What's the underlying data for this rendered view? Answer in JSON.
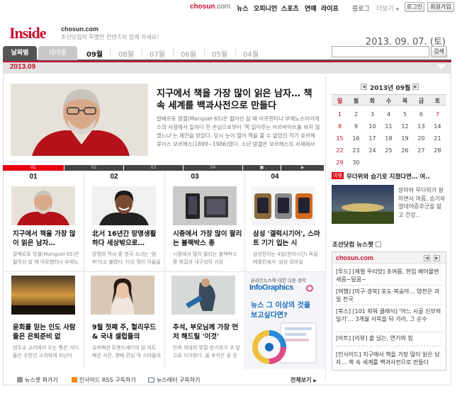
{
  "top_nav": {
    "logo": "chosun",
    "logo_suffix": ".com",
    "links": [
      "뉴스",
      "오피니언",
      "스포츠",
      "연예",
      "라이프"
    ],
    "blog": "블로그",
    "more": "더보기",
    "login": "로그인",
    "signup": "회원가입"
  },
  "brand": {
    "title": "Inside",
    "site": "chosun.com",
    "tagline": "조선닷컴의 특별한 컨텐츠와 함께 하세요!"
  },
  "date_display": "2013. 09. 07. (토)",
  "tabs": {
    "by_date": "날짜별",
    "by_theme": "테마별"
  },
  "months": [
    "09월",
    "08월",
    "07월",
    "06월",
    "05월",
    "04월"
  ],
  "search": {
    "button": "검색",
    "placeholder": ""
  },
  "current_month": "2013.09",
  "feature": {
    "title": "지구에서 책을 가장 많이 읽은 남자… 책 속 세계를 백과사전으로 만들다",
    "desc": "알베르토 망겔(Manguel·65)은 젊어선 살 때 아르헨티나 부에노스아이레스의 서점에서 일하다 한 손님으로부터 '책 읽어주는 아르바이트를 하지 않겠느냐'는 제안을 받았다. 당시 눈이 멀어 책을 볼 수 없었던 작가 호르헤 루이스 보르헤스(1899~1986)였다. 소년 망겔은 보르헤스의 서재에서"
  },
  "slider": {
    "segments": [
      "01",
      "02",
      "03",
      "04"
    ],
    "pause": "■",
    "next": "▶"
  },
  "grid": [
    {
      "num": "01",
      "title": "지구에서 책을 가장 많이 읽은 남자…",
      "desc": "알베르토 망겔(Manguel·65)은 젊어선 살 때 아르헨티나 부에노스"
    },
    {
      "num": "02",
      "title": "北서 16년간 망명생활하다 세상밖으로…",
      "desc": "망명의 역사 중 영국 소녀는 '캠퍼'라고 불렸다. 다섯 명이 아들을"
    },
    {
      "num": "03",
      "title": "시중에서 가장 많이 팔리는 블랙박스 총",
      "desc": "시중에서 많이 팔리는 블랙박스 중 화질과 내구성이 가장"
    },
    {
      "num": "04",
      "title": "삼성 '갤럭시기어', 스마트 기기 입는 시",
      "desc": "삼성전자는 4일(현지시간) 독일 베를린에서 '삼성 모바일"
    },
    {
      "num": "",
      "title": "윤회를 믿는 인도 사람들은 은퇴준비 없",
      "desc": "힌두교 교리에서 오는 통한 거다. 돌은 수천년 고귀하게 지난다"
    },
    {
      "num": "",
      "title": "9월 첫째 주, 헐리우드 & 국내 셀럽들의",
      "desc": "슈퍼패션 트렌드세터의 일 지도 패션 사진, 명배 관심 작 스타들의"
    },
    {
      "num": "",
      "title": "추석, 부모님께 가장 먼저 해드릴 '이것'",
      "desc": "민족 최대의 명절 한가위가 코 앞으로 다가왔다. 올 추석은 꽃 숫 어르신들께"
    }
  ],
  "ad": {
    "top": "온라인뉴스에 대한 다른 생각",
    "brand": "InfoGraphics",
    "line1": "뉴스 그 이상의 것을",
    "line2": "보고싶다면?"
  },
  "footer_links": {
    "pickup": "뉴스젯 퍼가기",
    "rss": "인사이드 RSS 구독하기",
    "newsletter": "뉴스레터 구독하기",
    "view_all": "전체보기"
  },
  "calendar": {
    "title": "2013년 09월",
    "days": [
      "일",
      "월",
      "화",
      "수",
      "목",
      "금",
      "토"
    ],
    "weeks": [
      [
        "1",
        "2",
        "3",
        "4",
        "5",
        "6",
        "7"
      ],
      [
        "8",
        "9",
        "10",
        "11",
        "12",
        "13",
        "14"
      ],
      [
        "15",
        "16",
        "17",
        "18",
        "19",
        "20",
        "21"
      ],
      [
        "22",
        "23",
        "24",
        "25",
        "26",
        "27",
        "28"
      ],
      [
        "29",
        "30",
        "",
        "",
        "",
        "",
        ""
      ]
    ],
    "highlight": "7"
  },
  "side_article": {
    "tag": "여행",
    "title": "무더위와 습기로 지쳤다면… 여..",
    "desc": "장마와 무더위가 왕하면서 여름, 습기와 열대야증후군을 앓고 건강.."
  },
  "newsjet": {
    "title": "조선닷컴 뉴스젯",
    "logo": "chosun.com",
    "items": [
      "[투드] [제철 우리맛] 초여름, 한입 베어물면 새콤~달콤~",
      "[여행] [미구·경북] 포도·복숭아… 영천은 과일 천국",
      "[북스] [101 파워 클래식] '어느 시골 신부의 일기'… 3개월 사목을 뒤 가라, 그 순수",
      "[아트] [리뷰] 출 넘는, 연기의 힘",
      "[인사이드] 지구에서 책을 가장 많이 읽은 남자… 책 속 세계를 백과사전으로 만들다"
    ]
  }
}
